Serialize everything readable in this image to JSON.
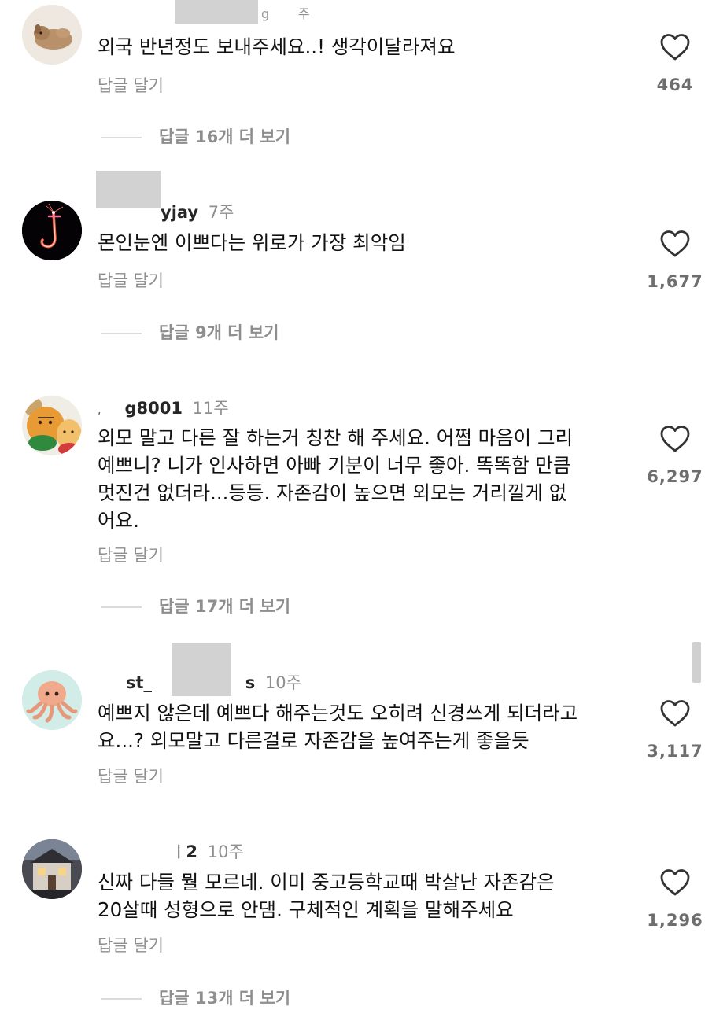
{
  "reply_label": "답글 달기",
  "comments": [
    {
      "username": "g",
      "age": "주",
      "text": "외국 반년정도 보내주세요..! 생각이달라져요",
      "likes": "464",
      "more_replies": "답글 16개 더 보기"
    },
    {
      "username": "yjay",
      "age": "7주",
      "text": "몬인눈엔 이쁘다는 위로가 가장 최악임",
      "likes": "1,677",
      "more_replies": "답글 9개 더 보기"
    },
    {
      "username": "g8001",
      "age": "11주",
      "text": "외모 말고 다른 잘 하는거 칭찬 해 주세요. 어쩜 마음이 그리\n예쁘니? 니가 인사하면 아빠 기분이 너무 좋아. 똑똑함 만큼\n멋진건 없더라...등등. 자존감이 높으면 외모는 거리낄게 없\n어요.",
      "likes": "6,297",
      "more_replies": "답글 17개 더 보기"
    },
    {
      "username": "st_",
      "username_suffix": "s",
      "age": "10주",
      "text": "예쁘지 않은데 예쁘다 해주는것도 오히려 신경쓰게 되더라고\n요...? 외모말고 다른걸로 자존감을 높여주는게 좋을듯",
      "likes": "3,117"
    },
    {
      "username": "2",
      "age": "10주",
      "text": "신짜 다들 뭘 모르네. 이미 중고등학교때 박살난 자존감은\n20살때 성형으로 안댐. 구체적인 계획을 말해주세요",
      "likes": "1,296",
      "more_replies": "답글 13개 더 보기"
    }
  ],
  "colors": {
    "secondary_text": "#8e8e8e",
    "like_count": "#6e6e6e",
    "divider": "#dbdbdb",
    "redaction": "#d2d2d2"
  },
  "icons": {
    "like": "heart-outline-icon"
  }
}
